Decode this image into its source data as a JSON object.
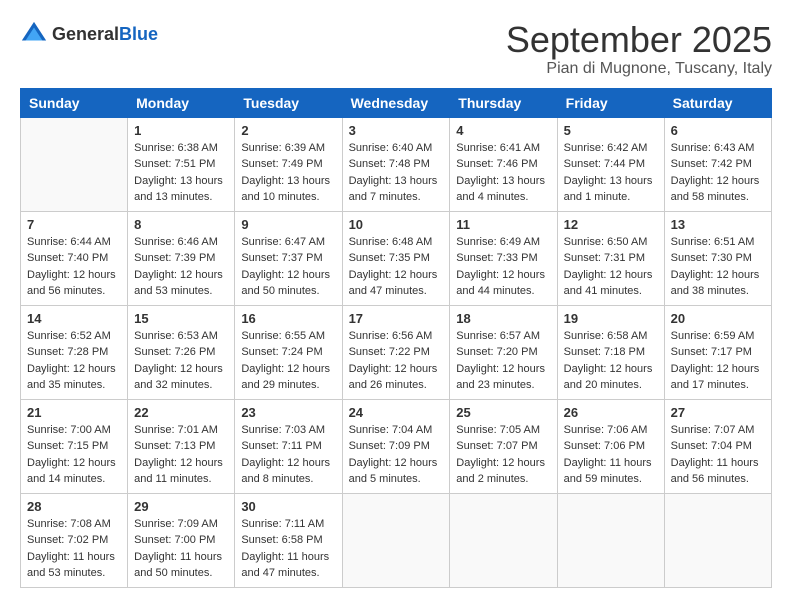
{
  "logo": {
    "text_general": "General",
    "text_blue": "Blue"
  },
  "title": {
    "month": "September 2025",
    "location": "Pian di Mugnone, Tuscany, Italy"
  },
  "days_of_week": [
    "Sunday",
    "Monday",
    "Tuesday",
    "Wednesday",
    "Thursday",
    "Friday",
    "Saturday"
  ],
  "weeks": [
    [
      {
        "num": "",
        "sunrise": "",
        "sunset": "",
        "daylight": ""
      },
      {
        "num": "1",
        "sunrise": "Sunrise: 6:38 AM",
        "sunset": "Sunset: 7:51 PM",
        "daylight": "Daylight: 13 hours and 13 minutes."
      },
      {
        "num": "2",
        "sunrise": "Sunrise: 6:39 AM",
        "sunset": "Sunset: 7:49 PM",
        "daylight": "Daylight: 13 hours and 10 minutes."
      },
      {
        "num": "3",
        "sunrise": "Sunrise: 6:40 AM",
        "sunset": "Sunset: 7:48 PM",
        "daylight": "Daylight: 13 hours and 7 minutes."
      },
      {
        "num": "4",
        "sunrise": "Sunrise: 6:41 AM",
        "sunset": "Sunset: 7:46 PM",
        "daylight": "Daylight: 13 hours and 4 minutes."
      },
      {
        "num": "5",
        "sunrise": "Sunrise: 6:42 AM",
        "sunset": "Sunset: 7:44 PM",
        "daylight": "Daylight: 13 hours and 1 minute."
      },
      {
        "num": "6",
        "sunrise": "Sunrise: 6:43 AM",
        "sunset": "Sunset: 7:42 PM",
        "daylight": "Daylight: 12 hours and 58 minutes."
      }
    ],
    [
      {
        "num": "7",
        "sunrise": "Sunrise: 6:44 AM",
        "sunset": "Sunset: 7:40 PM",
        "daylight": "Daylight: 12 hours and 56 minutes."
      },
      {
        "num": "8",
        "sunrise": "Sunrise: 6:46 AM",
        "sunset": "Sunset: 7:39 PM",
        "daylight": "Daylight: 12 hours and 53 minutes."
      },
      {
        "num": "9",
        "sunrise": "Sunrise: 6:47 AM",
        "sunset": "Sunset: 7:37 PM",
        "daylight": "Daylight: 12 hours and 50 minutes."
      },
      {
        "num": "10",
        "sunrise": "Sunrise: 6:48 AM",
        "sunset": "Sunset: 7:35 PM",
        "daylight": "Daylight: 12 hours and 47 minutes."
      },
      {
        "num": "11",
        "sunrise": "Sunrise: 6:49 AM",
        "sunset": "Sunset: 7:33 PM",
        "daylight": "Daylight: 12 hours and 44 minutes."
      },
      {
        "num": "12",
        "sunrise": "Sunrise: 6:50 AM",
        "sunset": "Sunset: 7:31 PM",
        "daylight": "Daylight: 12 hours and 41 minutes."
      },
      {
        "num": "13",
        "sunrise": "Sunrise: 6:51 AM",
        "sunset": "Sunset: 7:30 PM",
        "daylight": "Daylight: 12 hours and 38 minutes."
      }
    ],
    [
      {
        "num": "14",
        "sunrise": "Sunrise: 6:52 AM",
        "sunset": "Sunset: 7:28 PM",
        "daylight": "Daylight: 12 hours and 35 minutes."
      },
      {
        "num": "15",
        "sunrise": "Sunrise: 6:53 AM",
        "sunset": "Sunset: 7:26 PM",
        "daylight": "Daylight: 12 hours and 32 minutes."
      },
      {
        "num": "16",
        "sunrise": "Sunrise: 6:55 AM",
        "sunset": "Sunset: 7:24 PM",
        "daylight": "Daylight: 12 hours and 29 minutes."
      },
      {
        "num": "17",
        "sunrise": "Sunrise: 6:56 AM",
        "sunset": "Sunset: 7:22 PM",
        "daylight": "Daylight: 12 hours and 26 minutes."
      },
      {
        "num": "18",
        "sunrise": "Sunrise: 6:57 AM",
        "sunset": "Sunset: 7:20 PM",
        "daylight": "Daylight: 12 hours and 23 minutes."
      },
      {
        "num": "19",
        "sunrise": "Sunrise: 6:58 AM",
        "sunset": "Sunset: 7:18 PM",
        "daylight": "Daylight: 12 hours and 20 minutes."
      },
      {
        "num": "20",
        "sunrise": "Sunrise: 6:59 AM",
        "sunset": "Sunset: 7:17 PM",
        "daylight": "Daylight: 12 hours and 17 minutes."
      }
    ],
    [
      {
        "num": "21",
        "sunrise": "Sunrise: 7:00 AM",
        "sunset": "Sunset: 7:15 PM",
        "daylight": "Daylight: 12 hours and 14 minutes."
      },
      {
        "num": "22",
        "sunrise": "Sunrise: 7:01 AM",
        "sunset": "Sunset: 7:13 PM",
        "daylight": "Daylight: 12 hours and 11 minutes."
      },
      {
        "num": "23",
        "sunrise": "Sunrise: 7:03 AM",
        "sunset": "Sunset: 7:11 PM",
        "daylight": "Daylight: 12 hours and 8 minutes."
      },
      {
        "num": "24",
        "sunrise": "Sunrise: 7:04 AM",
        "sunset": "Sunset: 7:09 PM",
        "daylight": "Daylight: 12 hours and 5 minutes."
      },
      {
        "num": "25",
        "sunrise": "Sunrise: 7:05 AM",
        "sunset": "Sunset: 7:07 PM",
        "daylight": "Daylight: 12 hours and 2 minutes."
      },
      {
        "num": "26",
        "sunrise": "Sunrise: 7:06 AM",
        "sunset": "Sunset: 7:06 PM",
        "daylight": "Daylight: 11 hours and 59 minutes."
      },
      {
        "num": "27",
        "sunrise": "Sunrise: 7:07 AM",
        "sunset": "Sunset: 7:04 PM",
        "daylight": "Daylight: 11 hours and 56 minutes."
      }
    ],
    [
      {
        "num": "28",
        "sunrise": "Sunrise: 7:08 AM",
        "sunset": "Sunset: 7:02 PM",
        "daylight": "Daylight: 11 hours and 53 minutes."
      },
      {
        "num": "29",
        "sunrise": "Sunrise: 7:09 AM",
        "sunset": "Sunset: 7:00 PM",
        "daylight": "Daylight: 11 hours and 50 minutes."
      },
      {
        "num": "30",
        "sunrise": "Sunrise: 7:11 AM",
        "sunset": "Sunset: 6:58 PM",
        "daylight": "Daylight: 11 hours and 47 minutes."
      },
      {
        "num": "",
        "sunrise": "",
        "sunset": "",
        "daylight": ""
      },
      {
        "num": "",
        "sunrise": "",
        "sunset": "",
        "daylight": ""
      },
      {
        "num": "",
        "sunrise": "",
        "sunset": "",
        "daylight": ""
      },
      {
        "num": "",
        "sunrise": "",
        "sunset": "",
        "daylight": ""
      }
    ]
  ]
}
